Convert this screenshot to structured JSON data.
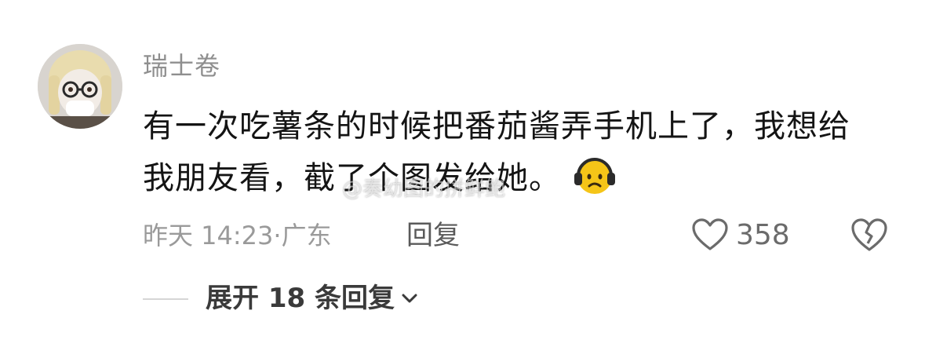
{
  "comment": {
    "username": "瑞士卷",
    "text": "有一次吃薯条的时候把番茄酱弄手机上了，我想给我朋友看，截了个图发给她。",
    "emoji": "sad-headphones-emoji",
    "timestamp": "昨天 14:23",
    "separator": "·",
    "location": "广东",
    "reply_label": "回复",
    "like_count": "358",
    "expand_label": "展开 18 条回复"
  },
  "watermark": "@奏幼图的拼鲜鲍",
  "colors": {
    "username": "#8f8f8f",
    "text": "#141414",
    "meta": "#9a9a9a",
    "emoji_face": "#f5c518"
  }
}
